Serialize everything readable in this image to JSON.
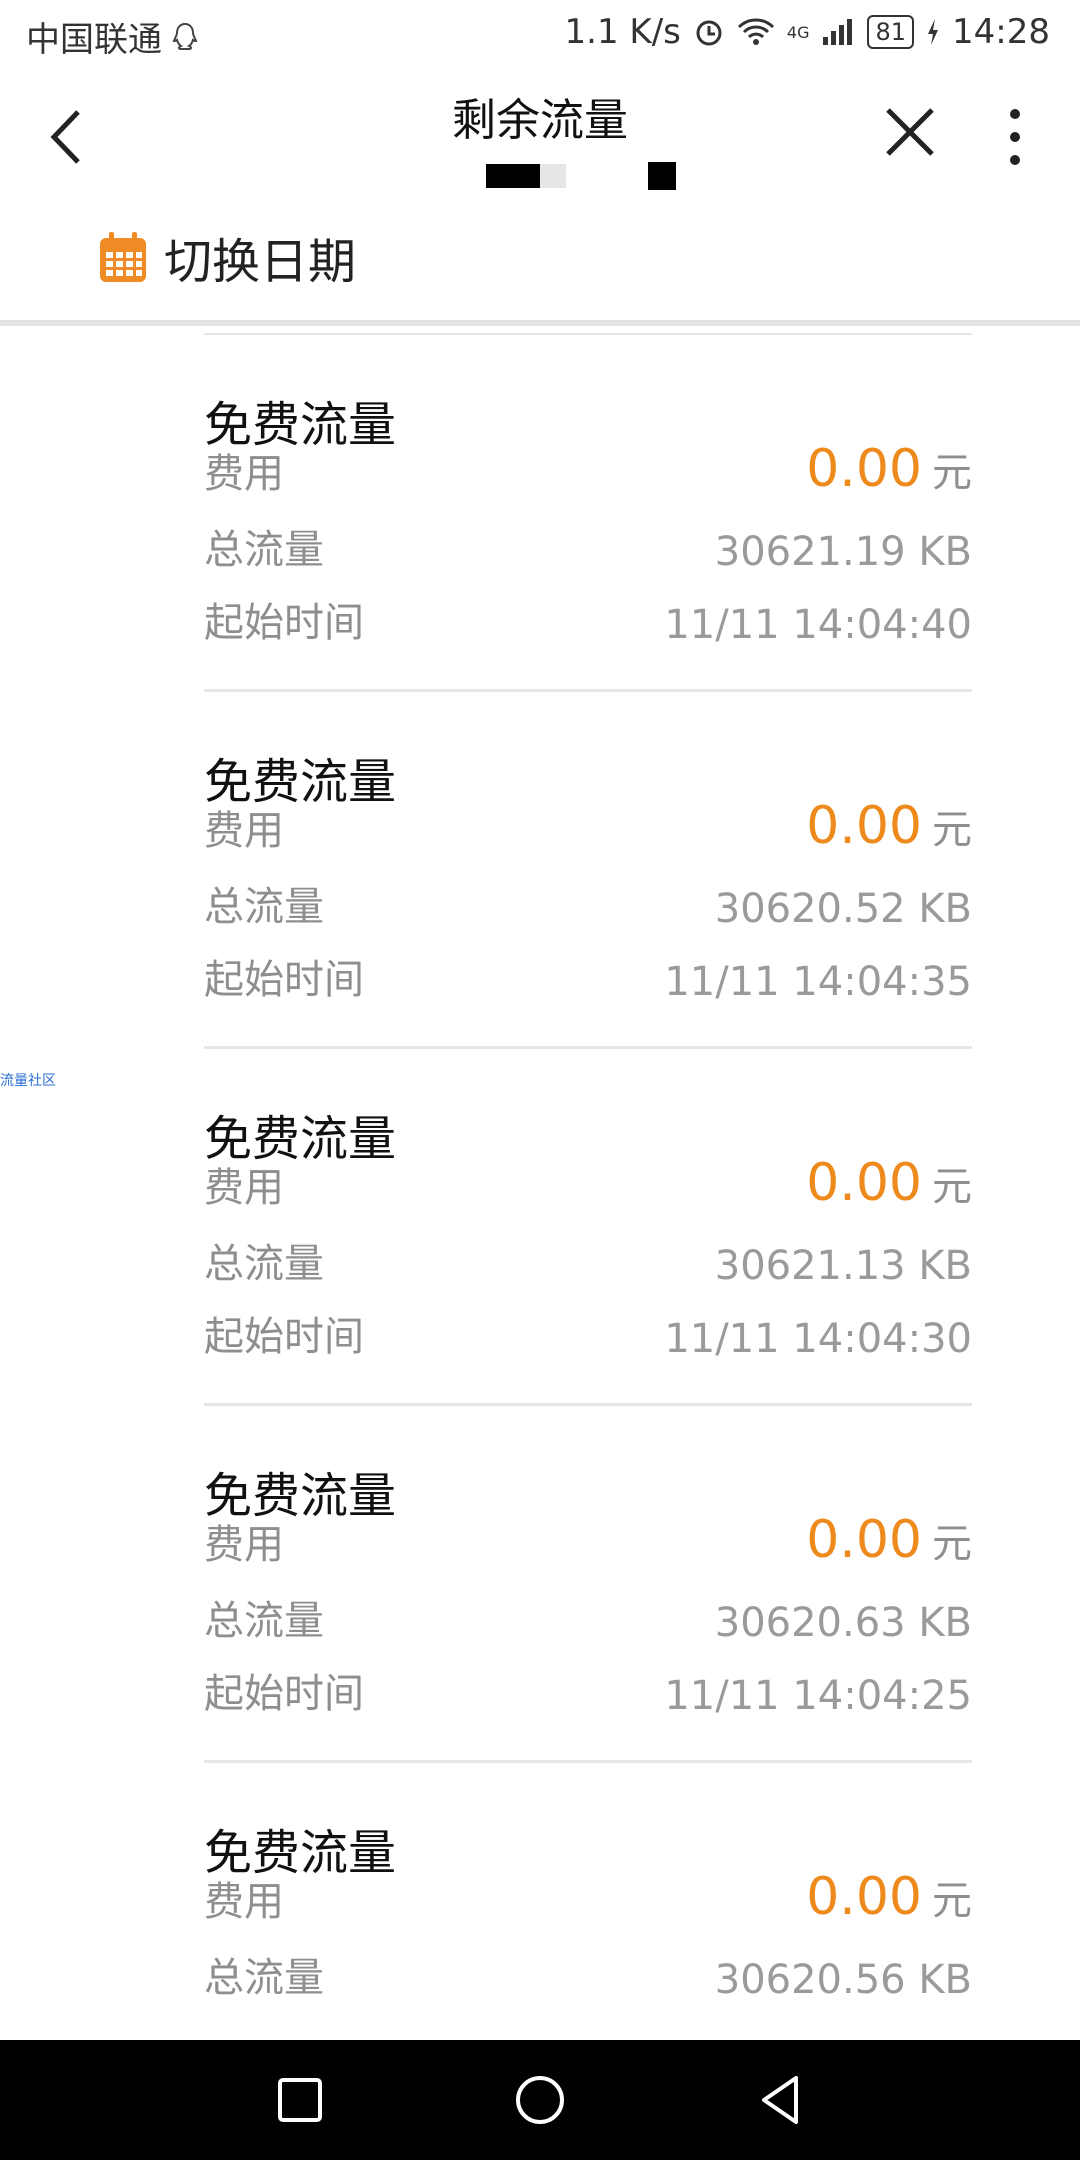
{
  "status_bar": {
    "carrier": "中国联通",
    "speed": "1.1 K/s",
    "network": "4G",
    "battery": "81",
    "time": "14:28"
  },
  "nav": {
    "title": "剩余流量"
  },
  "date_switch": {
    "label": "切换日期",
    "icon": "calendar-icon",
    "accent": "#f08a24"
  },
  "side_mark": "流量社区",
  "records": [
    {
      "title": "免费流量",
      "fee_label": "费用",
      "fee": "0.00",
      "fee_unit": "元",
      "traffic_label": "总流量",
      "traffic": "30621.19 KB",
      "time_label": "起始时间",
      "time": "11/11 14:04:40"
    },
    {
      "title": "免费流量",
      "fee_label": "费用",
      "fee": "0.00",
      "fee_unit": "元",
      "traffic_label": "总流量",
      "traffic": "30620.52 KB",
      "time_label": "起始时间",
      "time": "11/11 14:04:35"
    },
    {
      "title": "免费流量",
      "fee_label": "费用",
      "fee": "0.00",
      "fee_unit": "元",
      "traffic_label": "总流量",
      "traffic": "30621.13 KB",
      "time_label": "起始时间",
      "time": "11/11 14:04:30"
    },
    {
      "title": "免费流量",
      "fee_label": "费用",
      "fee": "0.00",
      "fee_unit": "元",
      "traffic_label": "总流量",
      "traffic": "30620.63 KB",
      "time_label": "起始时间",
      "time": "11/11 14:04:25"
    },
    {
      "title": "免费流量",
      "fee_label": "费用",
      "fee": "0.00",
      "fee_unit": "元",
      "traffic_label": "总流量",
      "traffic": "30620.56 KB"
    }
  ],
  "colors": {
    "fee": "#ee8a1c",
    "label": "#8e8e8e",
    "divider": "#e6e6e6"
  }
}
